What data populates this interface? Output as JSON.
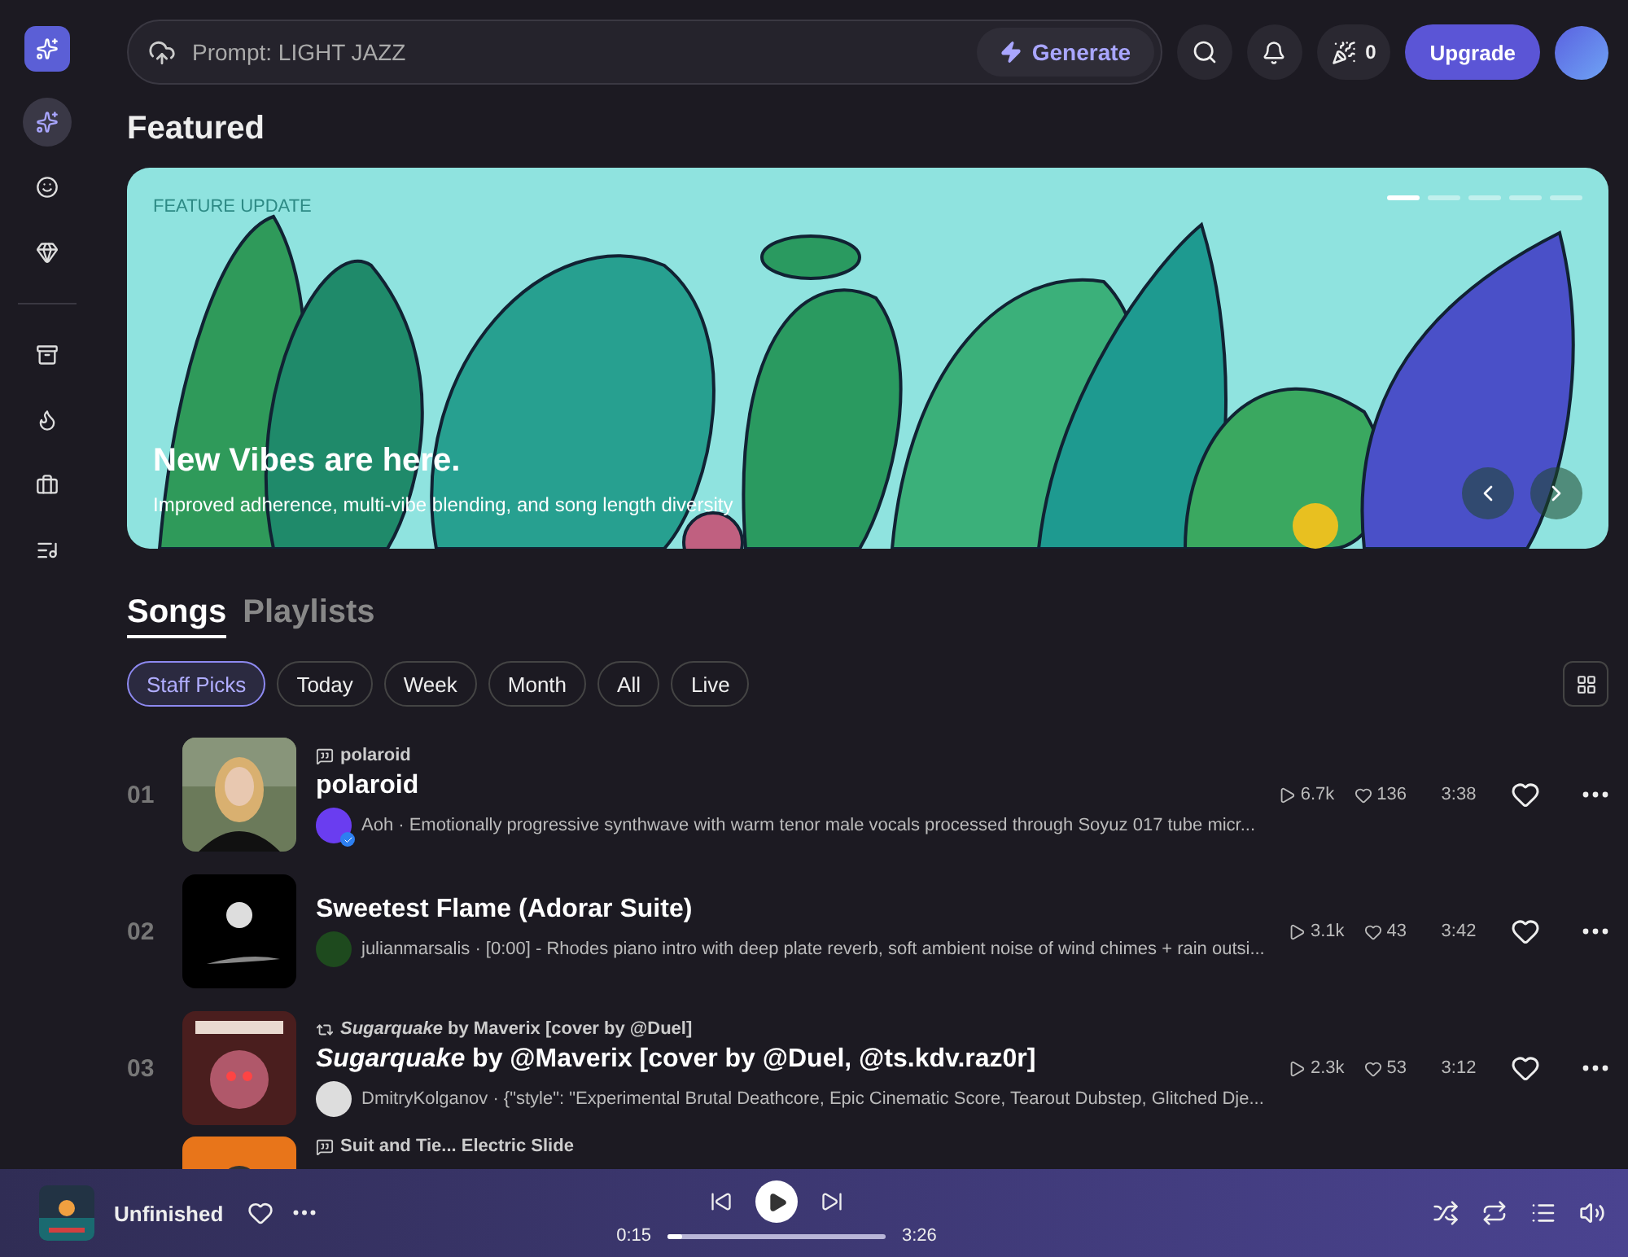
{
  "prompt": {
    "placeholder": "Prompt: LIGHT JAZZ",
    "button": "Generate"
  },
  "header": {
    "credits": "0",
    "upgrade": "Upgrade"
  },
  "sidebar": {
    "items": [
      {
        "selected": true
      },
      {
        "selected": false
      },
      {
        "selected": false
      },
      {
        "selected": false
      },
      {
        "selected": false
      },
      {
        "selected": false
      },
      {
        "selected": false
      }
    ]
  },
  "featured": {
    "heading": "Featured",
    "eyebrow": "FEATURE UPDATE",
    "title": "New Vibes are here.",
    "subtitle": "Improved adherence, multi-vibe blending, and song length diversity",
    "dots": [
      {
        "selected": true
      },
      {
        "selected": false
      },
      {
        "selected": false
      },
      {
        "selected": false
      },
      {
        "selected": false
      }
    ]
  },
  "tabs": [
    {
      "label": "Songs",
      "selected": true
    },
    {
      "label": "Playlists",
      "selected": false
    }
  ],
  "filters": [
    {
      "label": "Staff Picks",
      "selected": true
    },
    {
      "label": "Today",
      "selected": false
    },
    {
      "label": "Week",
      "selected": false
    },
    {
      "label": "Month",
      "selected": false
    },
    {
      "label": "All",
      "selected": false
    },
    {
      "label": "Live",
      "selected": false
    }
  ],
  "songs": [
    {
      "rank": "01",
      "kind": "inspo",
      "source": "polaroid",
      "title": "polaroid",
      "verified": true,
      "byline": "Aoh · Emotionally progressive synthwave with warm tenor male vocals processed through Soyuz 017 tube micr...",
      "plays": "6.7k",
      "likes": "136",
      "duration": "3:38",
      "liked": false
    },
    {
      "rank": "02",
      "kind": "none",
      "title": "Sweetest Flame (Adorar Suite)",
      "verified": false,
      "byline": "julianmarsalis · [0:00] - Rhodes piano intro with deep plate reverb, soft ambient noise of wind chimes + rain outsi...",
      "plays": "3.1k",
      "likes": "43",
      "duration": "3:42",
      "liked": false
    },
    {
      "rank": "03",
      "kind": "cover",
      "source": "*Sugarquake* by Maverix [cover by @Duel]",
      "title": "*Sugarquake* by @Maverix [cover by @Duel, @ts.kdv.raz0r]",
      "verified": false,
      "byline": "DmitryKolganov · {\"style\": \"Experimental Brutal Deathcore, Epic Cinematic Score, Tearout Dubstep, Glitched Dje...",
      "plays": "2.3k",
      "likes": "53",
      "duration": "3:12",
      "liked": false
    },
    {
      "kind": "inspo",
      "source": "Suit and Tie... Electric Slide"
    }
  ],
  "player": {
    "title": "Unfinished",
    "liked": false,
    "current": "0:15",
    "total": "3:26",
    "level": 0.07
  }
}
